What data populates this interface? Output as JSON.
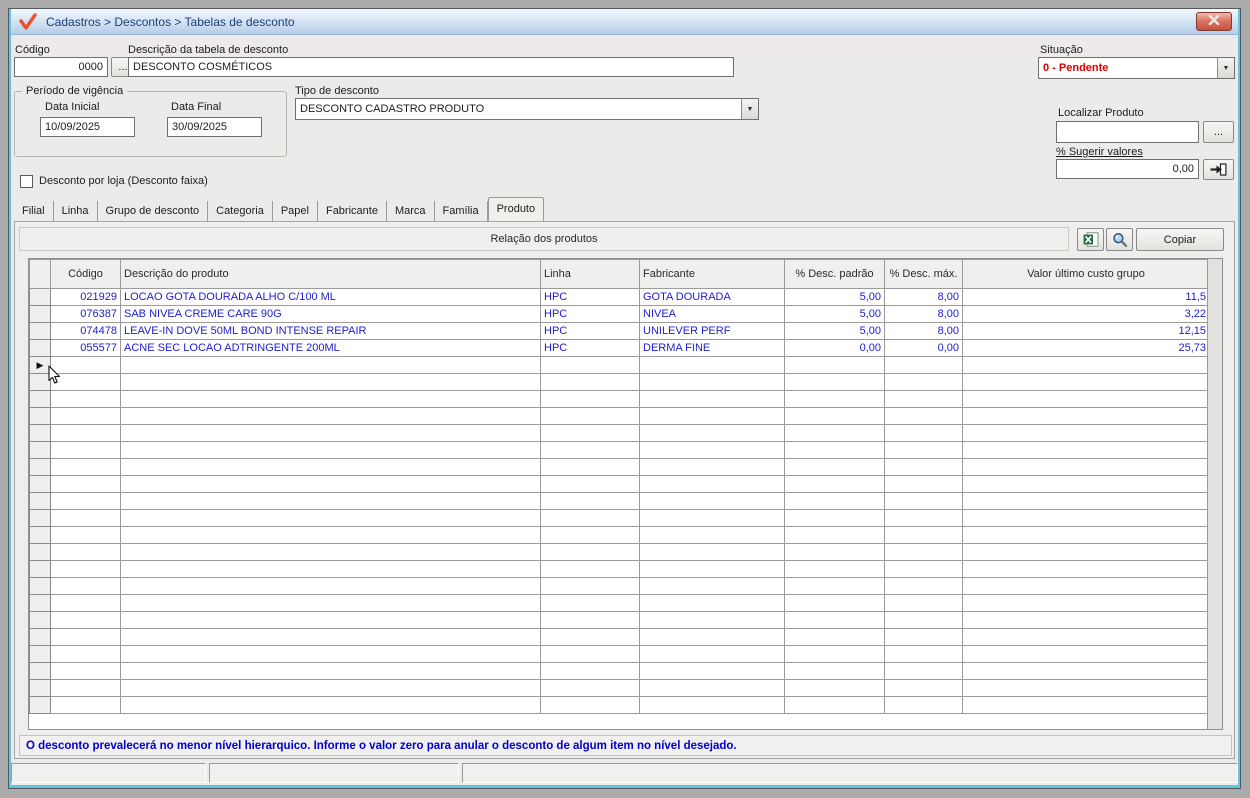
{
  "window": {
    "title": "Cadastros > Descontos > Tabelas de desconto",
    "close_label": "x"
  },
  "form": {
    "codigo": {
      "label": "Código",
      "value": "0000",
      "browse_label": "..."
    },
    "descricao": {
      "label": "Descrição da tabela de desconto",
      "value": "DESCONTO COSMÉTICOS"
    },
    "situacao": {
      "label": "Situação",
      "value": "0 - Pendente"
    },
    "periodo": {
      "legend": "Período de vigência",
      "data_inicial_label": "Data Inicial",
      "data_inicial_value": "10/09/2025",
      "data_final_label": "Data Final",
      "data_final_value": "30/09/2025"
    },
    "tipo_desconto": {
      "label": "Tipo de desconto",
      "value": "DESCONTO CADASTRO PRODUTO"
    },
    "localizar_produto": {
      "label": "Localizar Produto",
      "value": "",
      "browse_label": "..."
    },
    "sugerir_valores": {
      "label": "% Sugerir valores",
      "value": "0,00"
    },
    "desconto_loja_checkbox": {
      "label": "Desconto por loja (Desconto faixa)",
      "checked": false
    }
  },
  "tabs": [
    "Filial",
    "Linha",
    "Grupo de desconto",
    "Categoria",
    "Papel",
    "Fabricante",
    "Marca",
    "Família",
    "Produto"
  ],
  "active_tab": "Produto",
  "grid_panel": {
    "title": "Relação dos produtos",
    "copy_button_label": "Copiar",
    "icons": [
      "excel-export-icon",
      "magnifier-icon"
    ]
  },
  "grid": {
    "columns": [
      "Código",
      "Descrição do produto",
      "Linha",
      "Fabricante",
      "% Desc. padrão",
      "% Desc. máx.",
      "Valor último custo grupo"
    ],
    "rows": [
      [
        "021929",
        "LOCAO GOTA DOURADA ALHO C/100 ML",
        "HPC",
        "GOTA DOURADA",
        "5,00",
        "8,00",
        "11,5"
      ],
      [
        "076387",
        "SAB NIVEA CREME CARE 90G",
        "HPC",
        "NIVEA",
        "5,00",
        "8,00",
        "3,22"
      ],
      [
        "074478",
        "LEAVE-IN DOVE 50ML BOND INTENSE REPAIR",
        "HPC",
        "UNILEVER PERF",
        "5,00",
        "8,00",
        "12,15"
      ],
      [
        "055577",
        "ACNE SEC LOCAO ADTRINGENTE 200ML",
        "HPC",
        "DERMA FINE",
        "0,00",
        "0,00",
        "25,73"
      ]
    ],
    "empty_rows": 21,
    "current_row_index": 4,
    "current_row_marker": "▶"
  },
  "footer": {
    "message": "O desconto prevalecerá no menor nível hierarquico. Informe o valor zero para anular o desconto de algum item no nível desejado."
  },
  "colors": {
    "titlebar_text": "#1b3f77",
    "situacao_red": "#dd0000",
    "grid_text_blue": "#1d1dcf",
    "message_blue": "#0000cd",
    "window_accent_cyan": "#5bc8e6",
    "close_button_red": "#c4503f",
    "app_icon_orange": "#e8512e"
  }
}
